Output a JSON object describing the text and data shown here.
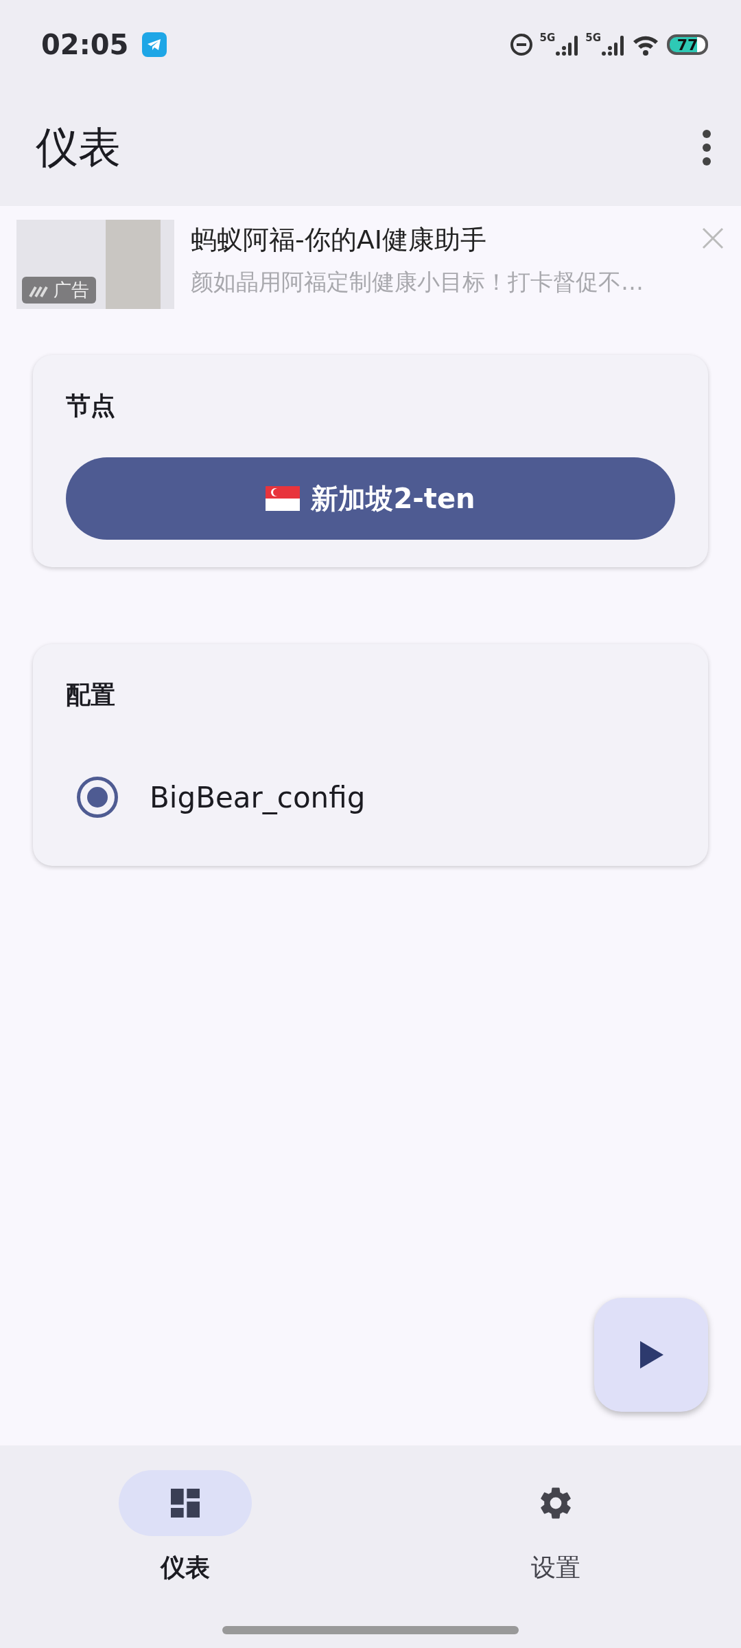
{
  "status_bar": {
    "time": "02:05",
    "network_labels": [
      "5G",
      "5G"
    ],
    "battery": "77"
  },
  "top_bar": {
    "title": "仪表"
  },
  "ad": {
    "title": "蚂蚁阿福-你的AI健康助手",
    "description": "颜如晶用阿福定制健康小目标！打卡督促不…",
    "badge": "广告"
  },
  "cards": [
    {
      "kind": "node",
      "title": "节点",
      "node_name": "新加坡2-ten"
    },
    {
      "kind": "config",
      "title": "配置",
      "options": [
        {
          "label": "BigBear_config",
          "selected": true
        }
      ]
    }
  ],
  "bottom_nav": [
    {
      "label": "仪表",
      "selected": true,
      "kind": "dashboard"
    },
    {
      "label": "设置",
      "selected": false,
      "kind": "settings"
    }
  ]
}
